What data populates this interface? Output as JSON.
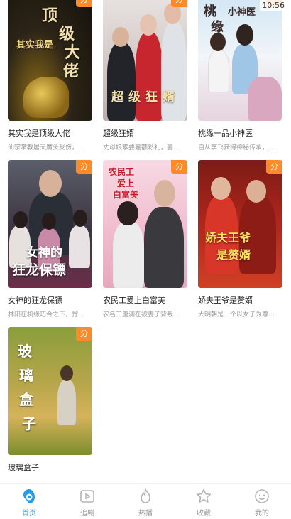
{
  "status": {
    "time": "10:56"
  },
  "badge_label": "分",
  "dramas": [
    {
      "title": "其实我是顶级大佬",
      "desc": "仙宗掌教屠天魔头受伤，…",
      "poster_text": [
        "顶",
        "级",
        "大",
        "佬"
      ],
      "poster_subtext": "其实我是"
    },
    {
      "title": "超级狂婿",
      "desc": "丈母娘索要嘉额彩礼，妻…",
      "poster_text": [
        "超",
        "级",
        "狂",
        "婿"
      ]
    },
    {
      "title": "桃缘一品小神医",
      "desc": "自从李飞获得神秘传承，…",
      "poster_text": [
        "桃",
        "缘"
      ],
      "poster_subtext": "小神医"
    },
    {
      "title": "女神的狂龙保镖",
      "desc": "林阳在机缘巧合之下，觉…",
      "poster_text": [
        "女神的",
        "狂龙保镖"
      ]
    },
    {
      "title": "农民工爱上白富美",
      "desc": "农名工唐渊在被妻子背叛…",
      "poster_text": [
        "农民工",
        "爱上",
        "白富美"
      ]
    },
    {
      "title": "娇夫王爷是赘婿",
      "desc": "大明朝是一个以女子为尊…",
      "poster_text": [
        "娇夫王爷",
        "是赘婿"
      ]
    },
    {
      "title": "玻璃盒子",
      "desc": "",
      "poster_text": [
        "玻",
        "璃",
        "盒",
        "子"
      ]
    }
  ],
  "tabbar": [
    {
      "label": "首页",
      "icon": "home-icon",
      "active": true
    },
    {
      "label": "追剧",
      "icon": "play-icon",
      "active": false
    },
    {
      "label": "热播",
      "icon": "flame-icon",
      "active": false
    },
    {
      "label": "收藏",
      "icon": "star-icon",
      "active": false
    },
    {
      "label": "我的",
      "icon": "smile-icon",
      "active": false
    }
  ],
  "colors": {
    "badge": "#ff8a2a",
    "active_tab": "#1f9cf0",
    "inactive_tab": "#999999"
  }
}
